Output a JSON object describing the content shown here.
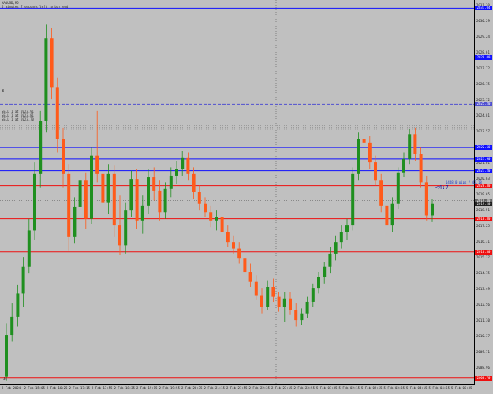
{
  "window": {
    "symbol_title": "XAUUSD,M5",
    "countdown_text": "5 minutes 7 seconds left to bar end"
  },
  "chart": {
    "background": "#c0c0c0",
    "bull_color": "#1f8f1f",
    "bear_color": "#ff5a1a",
    "price_min": 2008.5,
    "price_max": 2031.3,
    "candles": [
      [
        2008.8,
        2012.0,
        2008.5,
        2011.3
      ],
      [
        2011.3,
        2013.2,
        2010.9,
        2012.4
      ],
      [
        2012.4,
        2014.3,
        2011.8,
        2013.8
      ],
      [
        2013.8,
        2016.0,
        2013.0,
        2015.4
      ],
      [
        2015.4,
        2018.3,
        2015.0,
        2017.6
      ],
      [
        2017.6,
        2021.7,
        2017.0,
        2021.0
      ],
      [
        2021.0,
        2024.8,
        2020.2,
        2024.2
      ],
      [
        2024.2,
        2030.0,
        2023.5,
        2029.2
      ],
      [
        2029.2,
        2029.8,
        2025.5,
        2026.2
      ],
      [
        2026.2,
        2026.8,
        2022.3,
        2023.1
      ],
      [
        2023.1,
        2023.8,
        2020.2,
        2021.0
      ],
      [
        2021.0,
        2021.6,
        2016.4,
        2017.2
      ],
      [
        2017.2,
        2019.6,
        2016.8,
        2019.0
      ],
      [
        2019.0,
        2021.2,
        2018.5,
        2020.6
      ],
      [
        2020.6,
        2021.1,
        2017.7,
        2018.3
      ],
      [
        2018.3,
        2022.6,
        2018.0,
        2022.1
      ],
      [
        2022.1,
        2024.8,
        2020.5,
        2021.0
      ],
      [
        2021.0,
        2021.8,
        2018.7,
        2019.3
      ],
      [
        2019.3,
        2021.6,
        2018.6,
        2021.0
      ],
      [
        2021.0,
        2021.5,
        2017.2,
        2017.9
      ],
      [
        2017.9,
        2019.7,
        2016.1,
        2016.7
      ],
      [
        2016.7,
        2019.3,
        2016.2,
        2018.8
      ],
      [
        2018.8,
        2021.2,
        2018.4,
        2020.7
      ],
      [
        2020.7,
        2021.3,
        2017.7,
        2018.2
      ],
      [
        2018.2,
        2019.7,
        2017.4,
        2019.1
      ],
      [
        2019.1,
        2021.3,
        2018.6,
        2020.8
      ],
      [
        2020.8,
        2021.4,
        2019.4,
        2020.0
      ],
      [
        2020.0,
        2020.6,
        2018.2,
        2018.7
      ],
      [
        2018.7,
        2020.5,
        2018.3,
        2020.1
      ],
      [
        2020.1,
        2021.4,
        2019.6,
        2020.9
      ],
      [
        2020.9,
        2021.8,
        2020.4,
        2021.3
      ],
      [
        2021.3,
        2022.4,
        2020.9,
        2022.0
      ],
      [
        2022.0,
        2022.3,
        2020.6,
        2021.0
      ],
      [
        2021.0,
        2021.4,
        2019.5,
        2019.9
      ],
      [
        2019.9,
        2020.3,
        2018.8,
        2019.2
      ],
      [
        2019.2,
        2019.6,
        2018.4,
        2018.7
      ],
      [
        2018.7,
        2019.1,
        2017.8,
        2018.2
      ],
      [
        2018.2,
        2018.8,
        2017.6,
        2018.4
      ],
      [
        2018.4,
        2018.7,
        2017.2,
        2017.5
      ],
      [
        2017.5,
        2017.9,
        2016.6,
        2016.9
      ],
      [
        2016.9,
        2017.3,
        2016.2,
        2016.5
      ],
      [
        2016.5,
        2016.9,
        2015.6,
        2015.9
      ],
      [
        2015.9,
        2016.2,
        2014.9,
        2015.1
      ],
      [
        2015.1,
        2015.6,
        2014.2,
        2014.5
      ],
      [
        2014.5,
        2014.9,
        2013.4,
        2013.7
      ],
      [
        2013.7,
        2014.1,
        2012.6,
        2013.0
      ],
      [
        2013.0,
        2014.6,
        2012.8,
        2014.2
      ],
      [
        2014.2,
        2014.7,
        2013.3,
        2013.6
      ],
      [
        2013.6,
        2013.9,
        2012.7,
        2013.0
      ],
      [
        2013.0,
        2013.9,
        2012.1,
        2013.5
      ],
      [
        2013.5,
        2013.9,
        2012.5,
        2012.8
      ],
      [
        2012.8,
        2013.2,
        2011.8,
        2012.2
      ],
      [
        2012.2,
        2012.9,
        2011.9,
        2012.6
      ],
      [
        2012.6,
        2013.6,
        2012.3,
        2013.3
      ],
      [
        2013.3,
        2014.4,
        2013.0,
        2014.1
      ],
      [
        2014.1,
        2015.1,
        2013.8,
        2014.8
      ],
      [
        2014.8,
        2015.7,
        2014.4,
        2015.4
      ],
      [
        2015.4,
        2016.6,
        2015.0,
        2016.2
      ],
      [
        2016.2,
        2017.3,
        2015.8,
        2016.9
      ],
      [
        2016.9,
        2017.9,
        2016.5,
        2017.5
      ],
      [
        2017.5,
        2018.3,
        2017.0,
        2017.9
      ],
      [
        2017.9,
        2021.4,
        2017.6,
        2021.0
      ],
      [
        2021.0,
        2023.5,
        2020.6,
        2023.1
      ],
      [
        2023.1,
        2023.9,
        2022.5,
        2022.9
      ],
      [
        2022.9,
        2023.3,
        2021.3,
        2021.7
      ],
      [
        2021.7,
        2022.1,
        2020.3,
        2020.6
      ],
      [
        2020.6,
        2021.0,
        2018.7,
        2019.1
      ],
      [
        2019.1,
        2019.6,
        2017.5,
        2017.9
      ],
      [
        2017.9,
        2019.6,
        2017.5,
        2019.2
      ],
      [
        2019.2,
        2021.4,
        2018.9,
        2021.1
      ],
      [
        2021.1,
        2022.3,
        2020.8,
        2021.9
      ],
      [
        2021.9,
        2023.7,
        2021.6,
        2023.4
      ],
      [
        2023.4,
        2023.8,
        2021.8,
        2022.2
      ],
      [
        2022.2,
        2022.6,
        2020.2,
        2020.5
      ],
      [
        2020.5,
        2020.9,
        2018.2,
        2018.5
      ],
      [
        2018.5,
        2019.5,
        2018.1,
        2019.2
      ]
    ],
    "horizontal_lines": [
      {
        "price": 2031.0,
        "color": "#1010ff",
        "tag": "2031.04"
      },
      {
        "price": 2028.0,
        "color": "#1010ff",
        "tag": "2028.00"
      },
      {
        "price": 2025.2,
        "color": "#5050d0",
        "dashed": true,
        "tag": "2025.20"
      },
      {
        "price": 2022.6,
        "color": "#1010ff",
        "tag": "2022.60"
      },
      {
        "price": 2021.9,
        "color": "#1010ff",
        "tag": "2021.90"
      },
      {
        "price": 2021.2,
        "color": "#1010ff",
        "tag": "2021.20"
      },
      {
        "price": 2020.3,
        "color": "#ee1010",
        "tag": "2020.30"
      },
      {
        "price": 2019.4,
        "color": "#666666",
        "dotted": true,
        "tag": "2019.40"
      },
      {
        "price": 2018.3,
        "color": "#ee1010",
        "tag": "2018.30"
      },
      {
        "price": 2016.3,
        "color": "#ee1010",
        "tag": "2016.30"
      },
      {
        "price": 2008.7,
        "color": "#ee1010",
        "tag": "2008.70"
      }
    ],
    "order_labels": [
      "SELL 1 at 2023.91",
      "SELL 1 at 2023.81",
      "SELL 1 at 2023.70"
    ],
    "price_note": "1448.0 pips / 42.18",
    "countdown": "<4:7",
    "marker_left": "8",
    "marker_bottom": "34",
    "y_ticks": [
      "2031.30",
      "2030.29",
      "2029.24",
      "2028.61",
      "2027.72",
      "2026.75",
      "2025.72",
      "2024.81",
      "2023.57",
      "2022.45",
      "2021.61",
      "2020.63",
      "2019.65",
      "2018.51",
      "2017.25",
      "2016.31",
      "2015.37",
      "2014.75",
      "2013.49",
      "2012.56",
      "2011.30",
      "2010.37",
      "2009.71",
      "2008.96"
    ],
    "x_ticks": [
      "2 Feb 2024",
      "2 Feb 15:05",
      "2 Feb 16:25",
      "2 Feb 17:15",
      "2 Feb 17:55",
      "2 Feb 18:35",
      "2 Feb 19:15",
      "2 Feb 19:55",
      "2 Feb 20:35",
      "2 Feb 21:15",
      "2 Feb 21:55",
      "2 Feb 22:35",
      "2 Feb 23:15",
      "2 Feb 23:55",
      "5 Feb 01:35",
      "5 Feb 02:15",
      "5 Feb 02:55",
      "5 Feb 03:35",
      "5 Feb 04:15",
      "5 Feb 04:55",
      "5 Feb 05:35"
    ]
  }
}
